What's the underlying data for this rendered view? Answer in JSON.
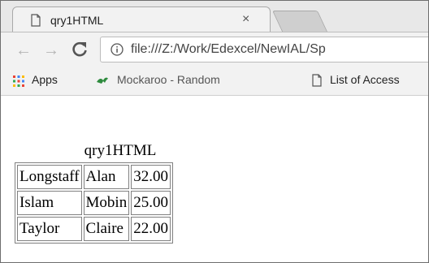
{
  "browser": {
    "tab": {
      "title": "qry1HTML",
      "close": "×"
    },
    "nav": {
      "back": "←",
      "forward": "→"
    },
    "address": {
      "url": "file:///Z:/Work/Edexcel/NewIAL/Sp"
    },
    "bookmarks": [
      {
        "label": "Apps",
        "icon": "apps-grid-icon"
      },
      {
        "label": "Mockaroo - Random",
        "icon": "mockaroo-icon"
      },
      {
        "label": "List of Access",
        "icon": "page-icon"
      }
    ]
  },
  "page": {
    "caption": "qry1HTML",
    "rows": [
      [
        "Longstaff",
        "Alan",
        "32.00"
      ],
      [
        "Islam",
        "Mobin",
        "25.00"
      ],
      [
        "Taylor",
        "Claire",
        "22.00"
      ]
    ]
  }
}
